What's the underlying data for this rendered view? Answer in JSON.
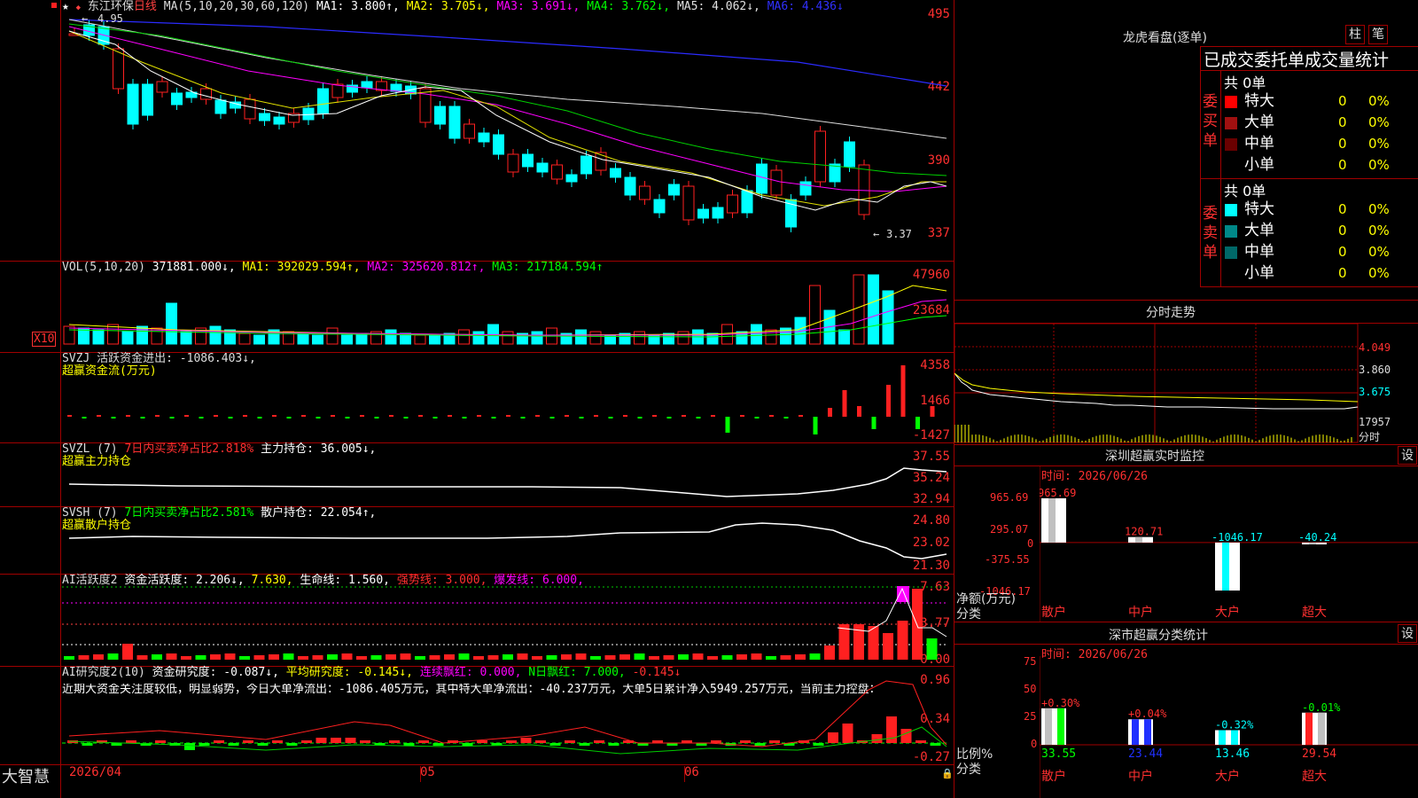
{
  "stock": {
    "name": "东江环保",
    "period": "日线",
    "star": "★"
  },
  "price_axis": [
    "495",
    "442",
    "390",
    "337"
  ],
  "price_legend": {
    "ma_spec": "MA(5,10,20,30,60,120)",
    "ma1": "MA1: 3.800↑,",
    "ma2": "MA2: 3.705↓,",
    "ma3": "MA3: 3.691↓,",
    "ma4": "MA4: 3.762↓,",
    "ma5": "MA5: 4.062↓,",
    "ma6": "MA6: 4.436↓",
    "high_label": "4.95",
    "low_label": "3.37"
  },
  "volume": {
    "axis": [
      "47960",
      "23684"
    ],
    "multiplier": "X10",
    "spec": "VOL(5,10,20)",
    "vol": "371881.000↓,",
    "ma1": "MA1: 392029.594↑,",
    "ma2": "MA2: 325620.812↑,",
    "ma3": "MA3: 217184.594↑"
  },
  "svzj": {
    "axis": [
      "4358",
      "1466",
      "-1427"
    ],
    "line1": "SVZJ  活跃资金进出: -1086.403↓,",
    "line2": "超赢资金流(万元)"
  },
  "svzl": {
    "axis": [
      "37.55",
      "35.24",
      "32.94"
    ],
    "prefix": "SVZL (7)",
    "ratio": "7日内买卖净占比2.818%",
    "holding": "主力持仓: 36.005↓,",
    "line2": "超赢主力持仓"
  },
  "svsh": {
    "axis": [
      "24.80",
      "23.02",
      "21.30"
    ],
    "prefix": "SVSH (7)",
    "ratio": "7日内买卖净占比2.581%",
    "holding": "散户持仓: 22.054↑,",
    "line2": "超赢散户持仓"
  },
  "ai_active": {
    "axis": [
      "7.63",
      "3.77",
      "0.00"
    ],
    "prefix": "AI活跃度2",
    "fund": "资金活跃度: 2.206↓,",
    "v2": "7.630,",
    "life": "生命线: 1.560,",
    "strong": "强势线: 3.000,",
    "burst": "爆发线: 6.000,"
  },
  "ai_research": {
    "axis": [
      "0.96",
      "0.34",
      "-0.27"
    ],
    "prefix": "AI研究度2(10)",
    "fund": "资金研究度: -0.087↓,",
    "avg": "平均研究度: -0.145↓,",
    "cont": "连续飘红: 0.000,",
    "nday": "N日飘红: 7.000,",
    "last": "-0.145↓",
    "comment": "近期大资金关注度较低，明显弱势，今日大单净流出：-1086.405万元，其中特大单净流出：-40.237万元，大单5日累计净入5949.257万元，当前主力控盘："
  },
  "date_axis": [
    "2026/04",
    "05",
    "06"
  ],
  "footer": {
    "logo": "大智慧"
  },
  "right": {
    "longhu_title": "龙虎看盘(逐单)",
    "tab_zhu": "柱",
    "tab_bi": "笔",
    "stats_title": "已成交委托单成交量统计",
    "buy_side": "委买单",
    "sell_side": "委卖单",
    "buy_total": "共 0单",
    "sell_total": "共 0单",
    "buy_rows": [
      {
        "label": "特大",
        "count": "0",
        "pct": "0%",
        "color": "#ff0000"
      },
      {
        "label": "大单",
        "count": "0",
        "pct": "0%",
        "color": "#a01010"
      },
      {
        "label": "中单",
        "count": "0",
        "pct": "0%",
        "color": "#6a0000"
      },
      {
        "label": "小单",
        "count": "0",
        "pct": "0%",
        "color": ""
      }
    ],
    "sell_rows": [
      {
        "label": "特大",
        "count": "0",
        "pct": "0%",
        "color": "#00ffff"
      },
      {
        "label": "大单",
        "count": "0",
        "pct": "0%",
        "color": "#008888"
      },
      {
        "label": "中单",
        "count": "0",
        "pct": "0%",
        "color": "#006868"
      },
      {
        "label": "小单",
        "count": "0",
        "pct": "0%",
        "color": ""
      }
    ],
    "intraday_title": "分时走势",
    "intraday_axis": [
      "4.049",
      "3.860",
      "3.675",
      "17957"
    ],
    "intraday_footer": "分时",
    "monitor_title": "深圳超赢实时监控",
    "monitor_btn": "设",
    "monitor_time": "时间: 2026/06/26",
    "monitor_axis": [
      "965.69",
      "295.07",
      "0",
      "-375.55",
      "-1046.17"
    ],
    "monitor_unit1": "净额(万元)",
    "monitor_unit2": "分类",
    "monitor_cats": [
      "散户",
      "中户",
      "大户",
      "超大"
    ],
    "monitor_values": [
      "965.69",
      "120.71",
      "-1046.17",
      "-40.24"
    ],
    "stat_title": "深市超赢分类统计",
    "stat_btn": "设",
    "stat_time": "时间: 2026/06/26",
    "stat_axis": [
      "75",
      "50",
      "25",
      "0"
    ],
    "stat_unit1": "比例%",
    "stat_unit2": "分类",
    "stat_changes": [
      "+0.30%",
      "+0.04%",
      "-0.32%",
      "-0.01%"
    ],
    "stat_values": [
      "33.55",
      "23.44",
      "13.46",
      "29.54"
    ],
    "stat_cats": [
      "散户",
      "中户",
      "大户",
      "超大"
    ]
  },
  "chart_data": [
    {
      "type": "bar",
      "title": "深圳超赢实时监控",
      "ylabel": "净额(万元)",
      "categories": [
        "散户",
        "中户",
        "大户",
        "超大"
      ],
      "values": [
        965.69,
        120.71,
        -1046.17,
        -40.24
      ],
      "ylim": [
        -1046.17,
        965.69
      ]
    },
    {
      "type": "bar",
      "title": "深市超赢分类统计",
      "ylabel": "比例%",
      "categories": [
        "散户",
        "中户",
        "大户",
        "超大"
      ],
      "values": [
        33.55,
        23.44,
        13.46,
        29.54
      ],
      "ylim": [
        0,
        75
      ]
    }
  ]
}
